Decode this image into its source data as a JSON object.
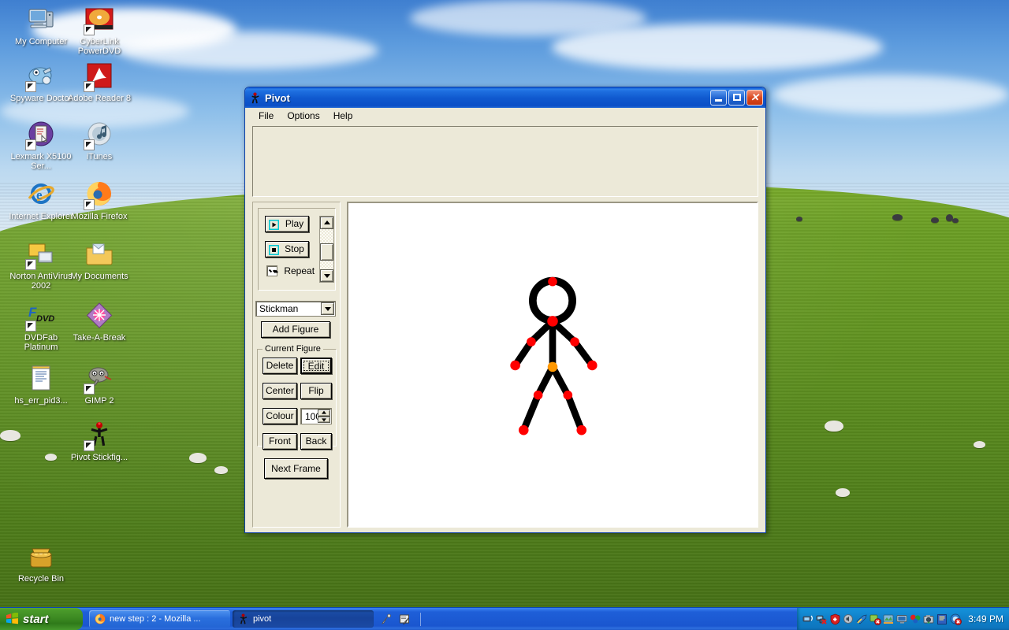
{
  "desktop": {
    "icons": [
      {
        "label": "My Computer",
        "icon": "my-computer-icon",
        "shortcut": false
      },
      {
        "label": "CyberLink PowerDVD",
        "icon": "powerdvd-icon",
        "shortcut": true
      },
      {
        "label": "Spyware Doctor",
        "icon": "spyware-doctor-icon",
        "shortcut": true
      },
      {
        "label": "Adobe Reader 8",
        "icon": "adobe-reader-icon",
        "shortcut": true
      },
      {
        "label": "Lexmark X5100 Ser...",
        "icon": "lexmark-printer-icon",
        "shortcut": true
      },
      {
        "label": "iTunes",
        "icon": "itunes-icon",
        "shortcut": true
      },
      {
        "label": "Internet Explorer",
        "icon": "internet-explorer-icon",
        "shortcut": false
      },
      {
        "label": "Mozilla Firefox",
        "icon": "firefox-icon",
        "shortcut": true
      },
      {
        "label": "Norton AntiVirus 2002",
        "icon": "norton-antivirus-icon",
        "shortcut": true
      },
      {
        "label": "My Documents",
        "icon": "my-documents-icon",
        "shortcut": false
      },
      {
        "label": "DVDFab Platinum",
        "icon": "dvdfab-icon",
        "shortcut": true
      },
      {
        "label": "Take-A-Break",
        "icon": "take-a-break-icon",
        "shortcut": false
      },
      {
        "label": "hs_err_pid3...",
        "icon": "text-document-icon",
        "shortcut": false
      },
      {
        "label": "GIMP 2",
        "icon": "gimp-icon",
        "shortcut": true
      },
      {
        "label": "Pivot Stickfig...",
        "icon": "pivot-stickfigure-icon",
        "shortcut": true
      },
      {
        "label": "Recycle Bin",
        "icon": "recycle-bin-icon",
        "shortcut": false
      }
    ]
  },
  "window": {
    "title": "Pivot",
    "title_icon": "pivot-stickfigure-icon",
    "buttons": {
      "minimize": "minimize-button",
      "maximize": "maximize-button",
      "close": "close-button"
    },
    "menu": [
      "File",
      "Options",
      "Help"
    ],
    "animation_controls": {
      "play_label": "Play",
      "stop_label": "Stop",
      "repeat_label": "Repeat",
      "repeat_checked": true,
      "speed_scroll": "animation-speed-scrollbar"
    },
    "figure_select": {
      "value": "Stickman",
      "options": [
        "Stickman"
      ]
    },
    "add_figure_label": "Add Figure",
    "current_figure": {
      "legend": "Current Figure",
      "delete_label": "Delete",
      "edit_label": "Edit",
      "edit_focused": true,
      "center_label": "Center",
      "flip_label": "Flip",
      "colour_label": "Colour",
      "size_value": "100",
      "front_label": "Front",
      "back_label": "Back"
    },
    "next_frame_label": "Next Frame",
    "frames_strip": {
      "frames": []
    },
    "canvas": {
      "background": "#ffffff",
      "figure": {
        "name": "Stickman",
        "limb_color": "#000000",
        "joint_color": "#ff0000",
        "hip_joint_color": "#ff9800"
      }
    }
  },
  "taskbar": {
    "start_label": "start",
    "tasks": [
      {
        "label": "new step : 2 - Mozilla ...",
        "icon": "firefox-icon",
        "active": false
      },
      {
        "label": "pivot",
        "icon": "pivot-stickfigure-icon",
        "active": true
      }
    ],
    "quick_icons": [
      "microphone-icon",
      "tablet-pen-icon"
    ],
    "tray_icons": [
      "network-icon",
      "network-disconnected-icon",
      "security-shield-icon",
      "volume-icon",
      "swordfish-icon",
      "antivirus-icon",
      "updates-icon",
      "display-icon",
      "balloons-icon",
      "camera-icon",
      "notes-icon",
      "messenger-icon"
    ],
    "clock": "3:49 PM"
  },
  "colors": {
    "titlebar_blue": "#1059cf",
    "face": "#ece9d8",
    "taskbar_blue": "#1a56cf",
    "start_green": "#3d8a22",
    "joint_red": "#ff0000",
    "hip_orange": "#ff9800"
  }
}
